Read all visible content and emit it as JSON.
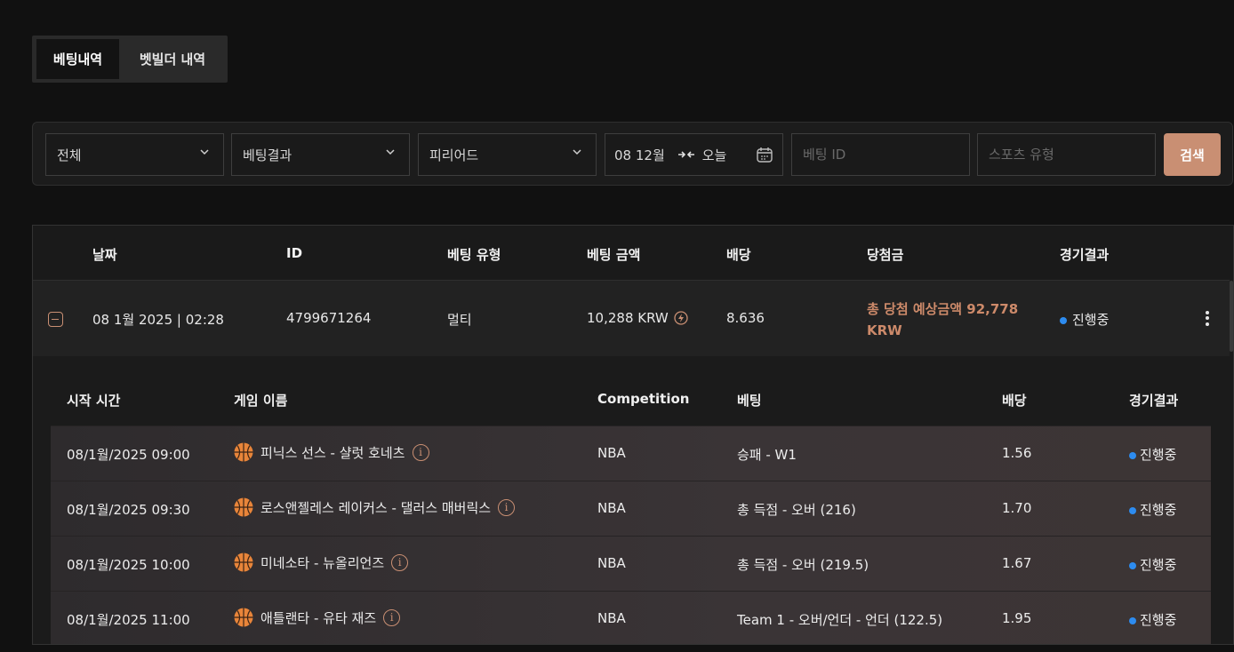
{
  "tabs": [
    {
      "label": "베팅내역",
      "active": true
    },
    {
      "label": "벳빌더 내역",
      "active": false
    }
  ],
  "filters": {
    "type_select": "전체",
    "result_select": "베팅결과",
    "period_select": "피리어드",
    "date_from": "08 12월",
    "date_to": "오늘",
    "bet_id_placeholder": "베팅 ID",
    "sport_type_placeholder": "스포츠 유형",
    "search_label": "검색"
  },
  "table": {
    "headers": [
      "날짜",
      "ID",
      "베팅 유형",
      "베팅 금액",
      "배당",
      "당첨금",
      "경기결과"
    ],
    "row": {
      "date": "08 1월 2025 | 02:28",
      "id": "4799671264",
      "bet_type": "멀티",
      "amount": "10,288 KRW",
      "odds": "8.636",
      "payout": "총 당첨 예상금액 92,778 KRW",
      "status": "진행중"
    }
  },
  "subtable": {
    "headers": [
      "시작 시간",
      "게임 이름",
      "Competition",
      "베팅",
      "배당",
      "경기결과"
    ],
    "rows": [
      {
        "time": "08/1월/2025 09:00",
        "game": "피닉스 선스 - 샬럿 호네츠",
        "competition": "NBA",
        "bet": "승패 - W1",
        "odds": "1.56",
        "status": "진행중"
      },
      {
        "time": "08/1월/2025 09:30",
        "game": "로스앤젤레스 레이커스 - 댈러스 매버릭스",
        "competition": "NBA",
        "bet": "총 득점 - 오버 (216)",
        "odds": "1.70",
        "status": "진행중"
      },
      {
        "time": "08/1월/2025 10:00",
        "game": "미네소타 - 뉴올리언즈",
        "competition": "NBA",
        "bet": "총 득점 - 오버 (219.5)",
        "odds": "1.67",
        "status": "진행중"
      },
      {
        "time": "08/1월/2025 11:00",
        "game": "애틀랜타 - 유타 재즈",
        "competition": "NBA",
        "bet": "Team 1 - 오버/언더 - 언더 (122.5)",
        "odds": "1.95",
        "status": "진행중"
      }
    ]
  },
  "colors": {
    "accent": "#c98f73",
    "status_live": "#2d8cf0",
    "background": "#111111"
  },
  "icons": [
    "chevron-down-icon",
    "swap-arrows-icon",
    "calendar-icon",
    "lightning-icon",
    "collapse-icon",
    "kebab-menu-icon",
    "basketball-icon",
    "info-icon"
  ]
}
